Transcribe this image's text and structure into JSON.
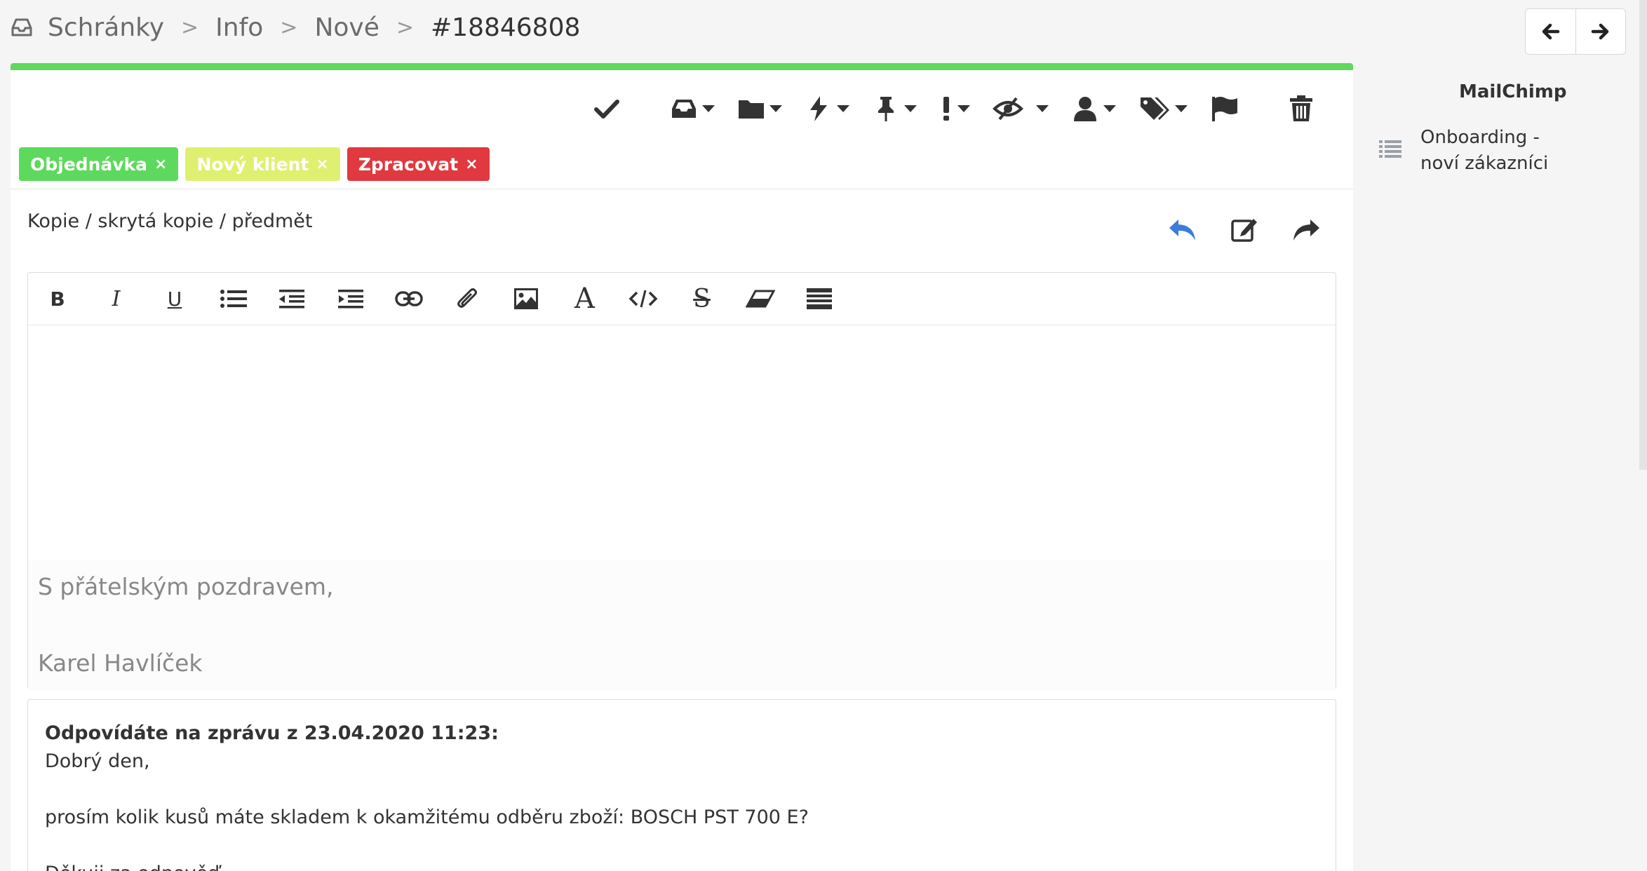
{
  "breadcrumb": {
    "items": [
      "Schránky",
      "Info",
      "Nové"
    ],
    "separator": ">",
    "current": "#18846808"
  },
  "toolbar": {
    "icons": [
      "check-icon",
      "inbox-icon",
      "folder-icon",
      "bolt-icon",
      "pin-icon",
      "exclamation-icon",
      "eye-slash-icon",
      "user-icon",
      "tags-icon",
      "flag-icon",
      "trash-icon"
    ]
  },
  "tags": [
    {
      "label": "Objednávka",
      "remove": "×",
      "color": "#5dd95d"
    },
    {
      "label": "Nový klient",
      "remove": "×",
      "color": "#dff071"
    },
    {
      "label": "Zpracovat",
      "remove": "×",
      "color": "#e0393f"
    }
  ],
  "compose": {
    "subject_toggle": "Kopie / skrytá kopie / předmět",
    "reply_actions": [
      "reply-icon",
      "edit-icon",
      "forward-icon"
    ]
  },
  "editor": {
    "toolbar": [
      "B",
      "I",
      "U",
      "bullet-list-icon",
      "outdent-icon",
      "indent-icon",
      "link-icon",
      "attachment-icon",
      "image-icon",
      "A",
      "code-icon",
      "S",
      "eraser-icon",
      "template-icon"
    ],
    "signature": {
      "line1": "S přátelským pozdravem,",
      "line2": "Karel Havlíček"
    }
  },
  "quote": {
    "header": "Odpovídáte na zprávu z 23.04.2020 11:23:",
    "greeting": "Dobrý den,",
    "body": "prosím kolik kusů máte skladem k okamžitému odběru zboží: BOSCH PST 700 E?",
    "closing": "Děkuji za odpověď"
  },
  "sidebar": {
    "title": "MailChimp",
    "items": [
      {
        "label": "Onboarding - noví zákazníci"
      }
    ]
  },
  "colors": {
    "accent_green": "#5dd95d",
    "reply_blue": "#3b7dd8"
  }
}
